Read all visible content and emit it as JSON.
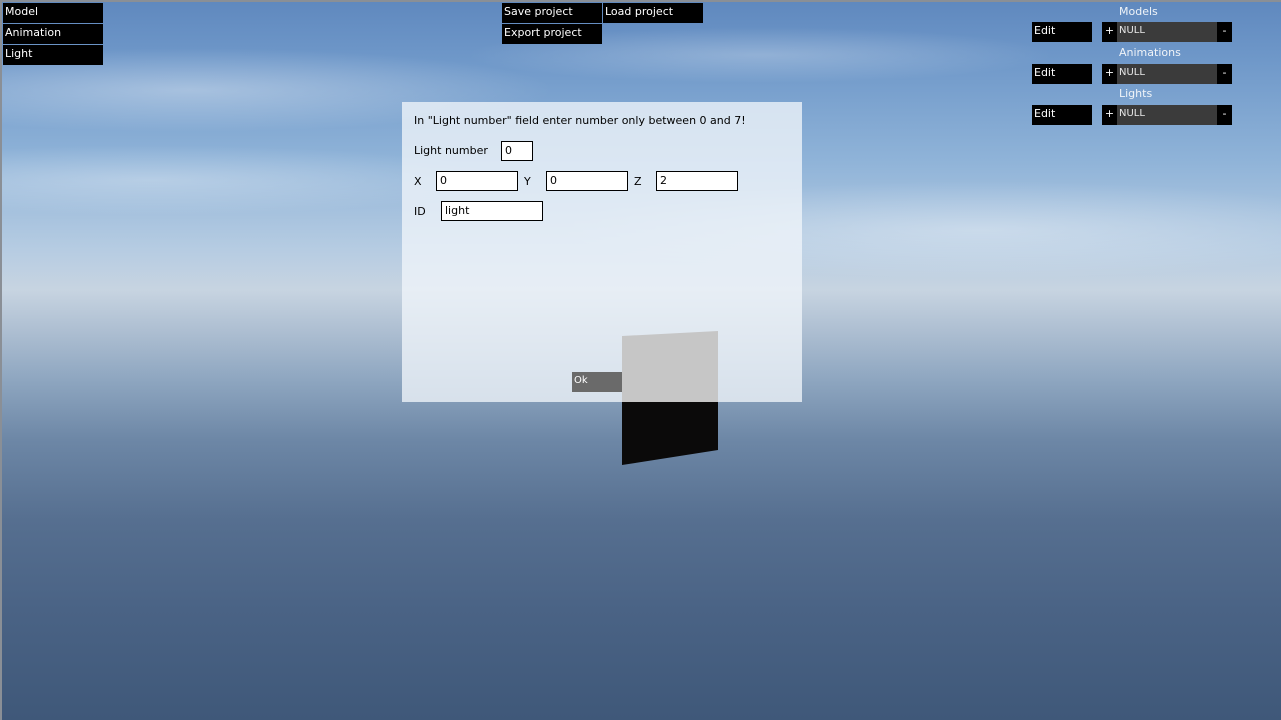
{
  "left_menu": {
    "items": [
      {
        "label": "Model"
      },
      {
        "label": "Animation"
      },
      {
        "label": "Light"
      }
    ]
  },
  "project_menu": {
    "save_label": "Save project",
    "load_label": "Load project",
    "export_label": "Export project"
  },
  "resources": [
    {
      "title": "Models",
      "edit_label": "Edit",
      "plus": "+",
      "selected": "NULL",
      "minus": "-"
    },
    {
      "title": "Animations",
      "edit_label": "Edit",
      "plus": "+",
      "selected": "NULL",
      "minus": "-"
    },
    {
      "title": "Lights",
      "edit_label": "Edit",
      "plus": "+",
      "selected": "NULL",
      "minus": "-"
    }
  ],
  "dialog": {
    "instruction": "In \"Light number\" field enter number only between 0 and 7!",
    "light_number_label": "Light number",
    "light_number_value": "0",
    "x_label": "X",
    "x_value": "0",
    "y_label": "Y",
    "y_value": "0",
    "z_label": "Z",
    "z_value": "2",
    "id_label": "ID",
    "id_value": "light",
    "ok_label": "Ok"
  },
  "colors": {
    "button_bg": "#000000",
    "dialog_bg": "#f0f5fa",
    "ok_bg": "#6a6a6a",
    "select_bg": "#3b3b3b"
  }
}
